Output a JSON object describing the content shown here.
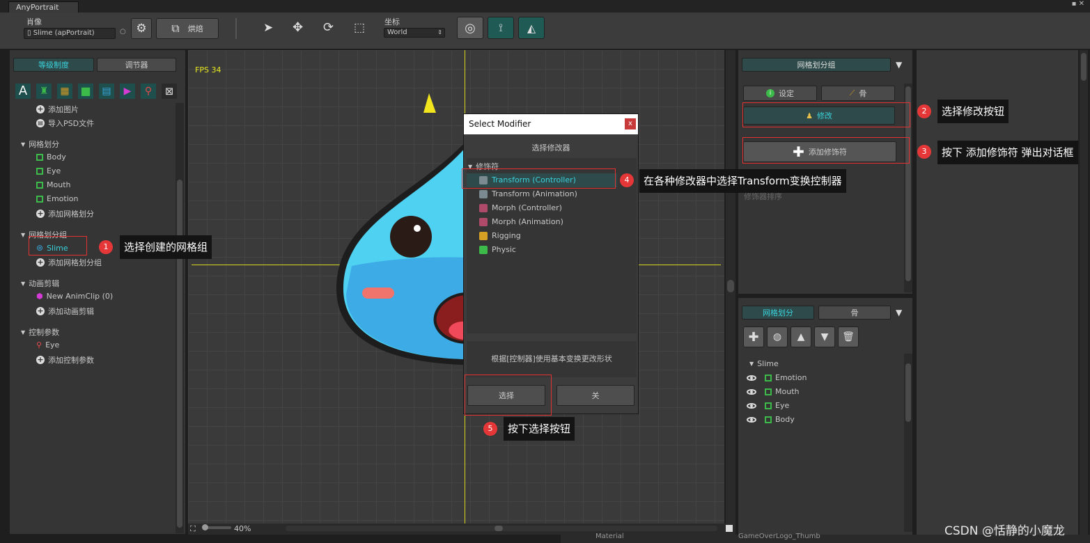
{
  "app": {
    "tab_title": "AnyPortrait",
    "window_controls": "▪ ✕"
  },
  "toolbar": {
    "portrait_label": "肖像",
    "portrait_value": "Slime (apPortrait)",
    "bake_label": "烘焙",
    "coord_label": "坐标",
    "coord_value": "World",
    "icons": [
      "gear-icon",
      "external-icon",
      "select-arrow-icon",
      "move-icon",
      "rotate-icon",
      "scale-icon",
      "onion-icon",
      "bone-icon",
      "mesh-icon"
    ]
  },
  "left": {
    "tabs": [
      "等级制度",
      "调节器"
    ],
    "tools": [
      "A",
      "▣",
      "▦",
      "■",
      "▤",
      "▶",
      "⚲",
      "⊠"
    ],
    "tree": {
      "add_image": "添加图片",
      "import_psd": "导入PSD文件",
      "meshes_header": "网格划分",
      "meshes": [
        "Body",
        "Eye",
        "Mouth",
        "Emotion"
      ],
      "add_mesh": "添加网格划分",
      "groups_header": "网格划分组",
      "group_item": "Slime",
      "add_group": "添加网格划分组",
      "anim_header": "动画剪辑",
      "anim_item": "New AnimClip (0)",
      "add_anim": "添加动画剪辑",
      "params_header": "控制参数",
      "param_item": "Eye",
      "add_param": "添加控制参数"
    }
  },
  "viewport": {
    "fps": "FPS 34",
    "zoom": "40%"
  },
  "dialog": {
    "title": "Select Modifier",
    "close": "x",
    "subtitle": "选择修改器",
    "section": "修饰符",
    "items": [
      "Transform (Controller)",
      "Transform (Animation)",
      "Morph (Controller)",
      "Morph (Animation)",
      "Rigging",
      "Physic"
    ],
    "description": "根据[控制器]使用基本变换更改形状",
    "select_button": "选择",
    "close_button": "关"
  },
  "right": {
    "group_header": "网格划分组",
    "tab_settings": "设定",
    "tab_bone": "骨",
    "modify_button": "修改",
    "add_modifier_button": "添加修饰符",
    "behind_text": "修饰器排序",
    "bottom_tabs": [
      "网格划分",
      "骨"
    ],
    "hier_root": "Slime",
    "hier_items": [
      "Emotion",
      "Mouth",
      "Eye",
      "Body"
    ]
  },
  "bottom": {
    "left_text": "Material",
    "right_text": "GameOverLogo_Thumb"
  },
  "annotations": [
    {
      "num": "1",
      "text": "选择创建的网格组"
    },
    {
      "num": "2",
      "text": "选择修改按钮"
    },
    {
      "num": "3",
      "text": "按下 添加修饰符 弹出对话框"
    },
    {
      "num": "4",
      "text": "在各种修改器中选择Transform变换控制器"
    },
    {
      "num": "5",
      "text": "按下选择按钮"
    }
  ],
  "watermark": "CSDN @恬静的小魔龙",
  "colors": {
    "accent_teal": "#39d2dc",
    "annotation_red": "#e53737",
    "yellow": "#e8e820",
    "mesh_green": "#3dbb4a"
  }
}
